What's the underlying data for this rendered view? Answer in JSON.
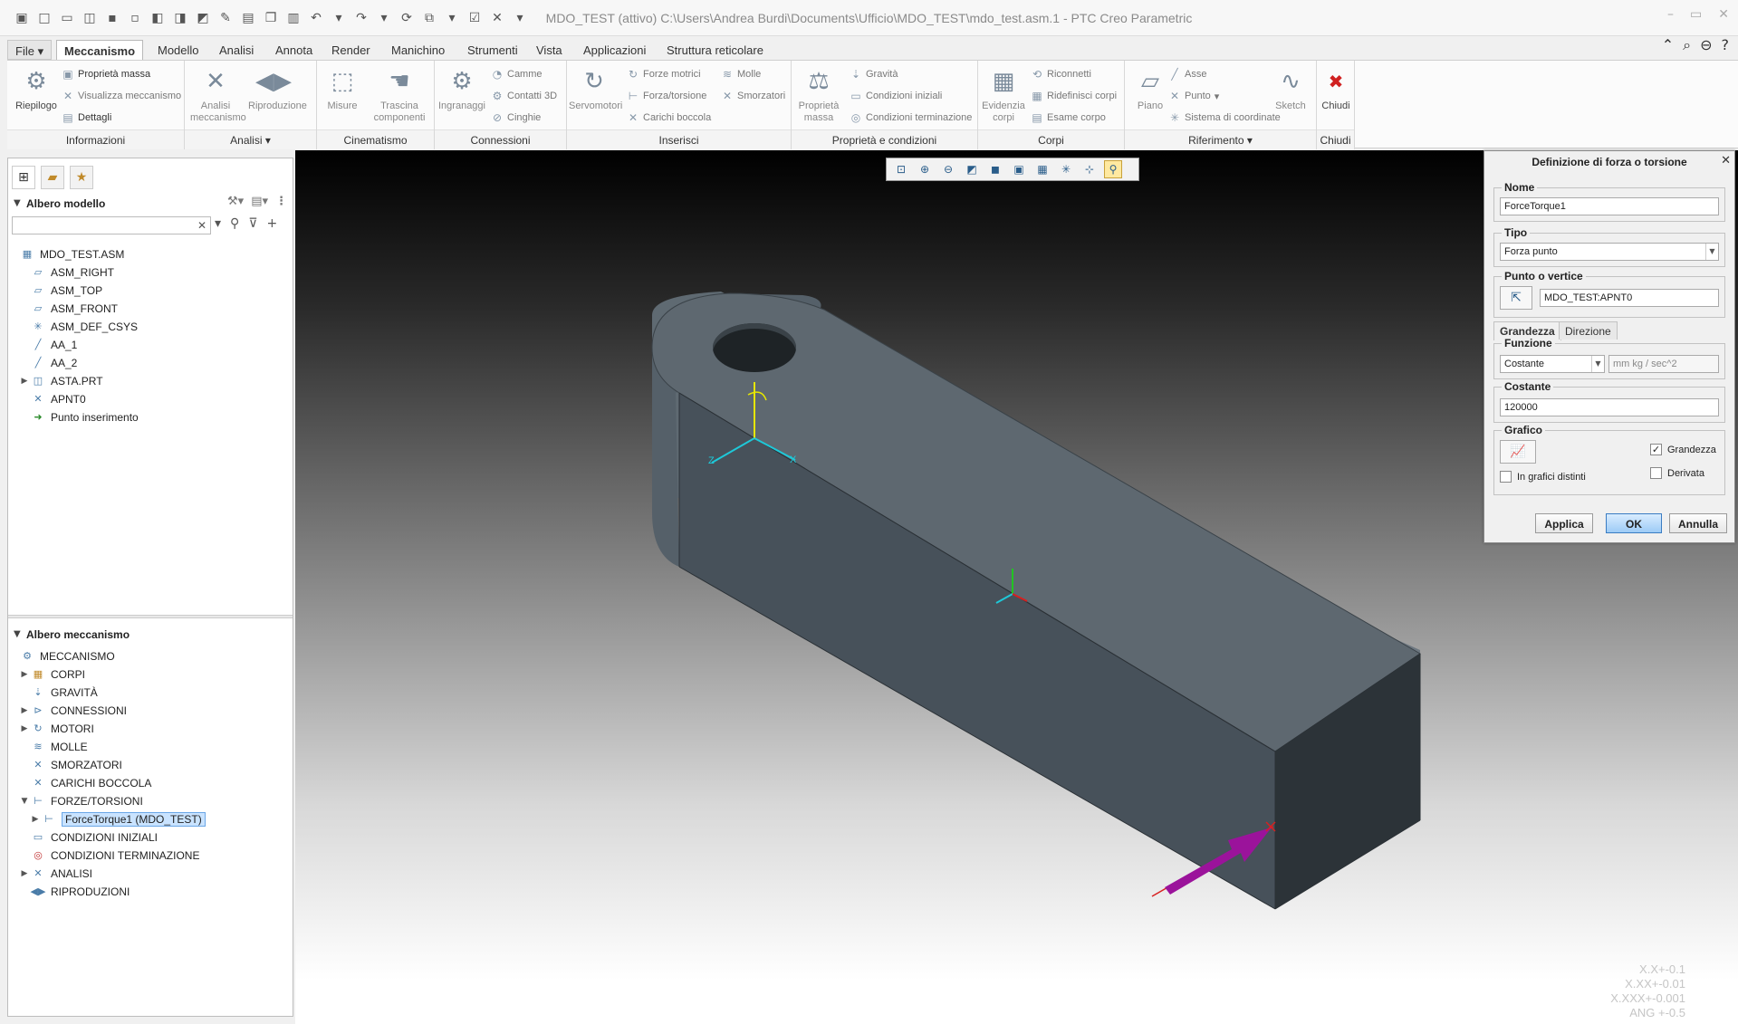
{
  "window": {
    "title": "MDO_TEST (attivo) C:\\Users\\Andrea Burdi\\Documents\\Ufficio\\MDO_TEST\\mdo_test.asm.1 - PTC Creo Parametric"
  },
  "tabs": [
    "File",
    "Meccanismo",
    "Modello",
    "Analisi",
    "Annota",
    "Render",
    "Manichino",
    "Strumenti",
    "Vista",
    "Applicazioni",
    "Struttura reticolare"
  ],
  "ribbon": {
    "riepilogo": "Riepilogo",
    "proprieta_massa": "Proprietà massa",
    "visualizza_meccanismo": "Visualizza meccanismo",
    "dettagli": "Dettagli",
    "analisi_meccanismo": "Analisi meccanismo",
    "riproduzione": "Riproduzione",
    "misure": "Misure",
    "trascina_componenti": "Trascina componenti",
    "ingranaggi": "Ingranaggi",
    "camme": "Camme",
    "contatti_3d": "Contatti 3D",
    "cinghie": "Cinghie",
    "servomotori": "Servomotori",
    "forze_motrici": "Forze motrici",
    "forza_torsione": "Forza/torsione",
    "carichi_boccola": "Carichi boccola",
    "molle": "Molle",
    "smorzatori": "Smorzatori",
    "proprieta_massa2": "Proprietà massa",
    "gravita": "Gravità",
    "condizioni_iniziali": "Condizioni iniziali",
    "condizioni_terminazione": "Condizioni terminazione",
    "evidenzia_corpi": "Evidenzia corpi",
    "riconnetti": "Riconnetti",
    "ridefinisci_corpi": "Ridefinisci corpi",
    "esame_corpo": "Esame corpo",
    "piano": "Piano",
    "asse": "Asse",
    "punto": "Punto",
    "sistema_coordinate": "Sistema di coordinate",
    "sketch": "Sketch",
    "chiudi": "Chiudi",
    "groups": {
      "informazioni": "Informazioni",
      "analisi": "Analisi",
      "cinematismo": "Cinematismo",
      "connessioni": "Connessioni",
      "inserisci": "Inserisci",
      "proprieta_condizioni": "Proprietà e condizioni",
      "corpi": "Corpi",
      "riferimento": "Riferimento",
      "chiudi": "Chiudi"
    }
  },
  "model_tree": {
    "title": "Albero modello",
    "items": [
      {
        "label": "MDO_TEST.ASM",
        "icon": "assembly-icon"
      },
      {
        "label": "ASM_RIGHT",
        "icon": "plane-icon"
      },
      {
        "label": "ASM_TOP",
        "icon": "plane-icon"
      },
      {
        "label": "ASM_FRONT",
        "icon": "plane-icon"
      },
      {
        "label": "ASM_DEF_CSYS",
        "icon": "csys-icon"
      },
      {
        "label": "AA_1",
        "icon": "axis-icon"
      },
      {
        "label": "AA_2",
        "icon": "axis-icon"
      },
      {
        "label": "ASTA.PRT",
        "icon": "part-icon"
      },
      {
        "label": "APNT0",
        "icon": "point-icon"
      },
      {
        "label": "Punto inserimento",
        "icon": "insert-arrow-icon"
      }
    ]
  },
  "mech_tree": {
    "title": "Albero meccanismo",
    "items": [
      {
        "label": "MECCANISMO",
        "icon": "mechanism-icon"
      },
      {
        "label": "CORPI",
        "icon": "bodies-icon"
      },
      {
        "label": "GRAVITÀ",
        "icon": "gravity-icon"
      },
      {
        "label": "CONNESSIONI",
        "icon": "connections-icon"
      },
      {
        "label": "MOTORI",
        "icon": "motor-icon"
      },
      {
        "label": "MOLLE",
        "icon": "spring-icon"
      },
      {
        "label": "SMORZATORI",
        "icon": "damper-icon"
      },
      {
        "label": "CARICHI BOCCOLA",
        "icon": "bushing-icon"
      },
      {
        "label": "FORZE/TORSIONI",
        "icon": "force-icon"
      },
      {
        "label": "ForceTorque1 (MDO_TEST)",
        "icon": "force-icon"
      },
      {
        "label": "CONDIZIONI INIZIALI",
        "icon": "initial-conditions-icon"
      },
      {
        "label": "CONDIZIONI TERMINAZIONE",
        "icon": "termination-icon"
      },
      {
        "label": "ANALISI",
        "icon": "analysis-icon"
      },
      {
        "label": "RIPRODUZIONI",
        "icon": "playback-icon"
      }
    ]
  },
  "viewport": {
    "tolerance": [
      "X.X+-0.1",
      "X.XX+-0.01",
      "X.XXX+-0.001",
      "ANG +-0.5"
    ]
  },
  "dialog": {
    "title": "Definizione di forza o torsione",
    "nome_label": "Nome",
    "nome_value": "ForceTorque1",
    "tipo_label": "Tipo",
    "tipo_value": "Forza punto",
    "punto_label": "Punto o vertice",
    "punto_value": "MDO_TEST:APNT0",
    "tab_grandezza": "Grandezza",
    "tab_direzione": "Direzione",
    "funzione_label": "Funzione",
    "funzione_value": "Costante",
    "unita": "mm kg / sec^2",
    "costante_label": "Costante",
    "costante_value": "120000",
    "grafico_label": "Grafico",
    "chk_grandezza": "Grandezza",
    "chk_derivata": "Derivata",
    "chk_grafici": "In grafici distinti",
    "btn_applica": "Applica",
    "btn_ok": "OK",
    "btn_annulla": "Annulla"
  },
  "colors": {
    "selection": "#c9e3ff",
    "accent": "#3a7cc2",
    "force_arrow": "#9b139b",
    "csys": "#1ec8d8"
  }
}
